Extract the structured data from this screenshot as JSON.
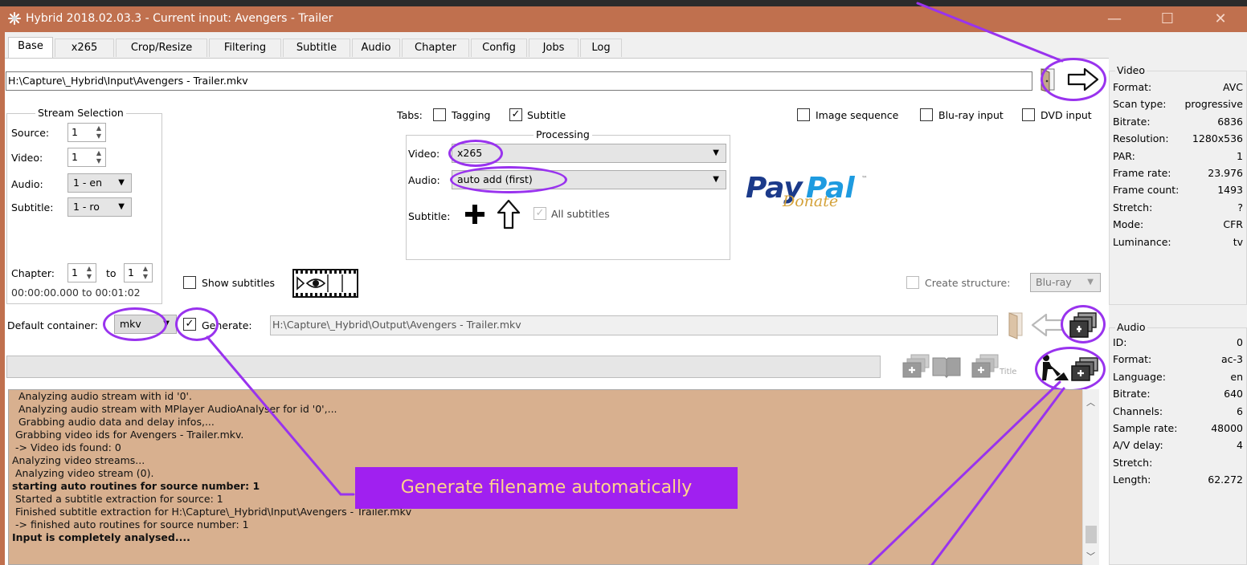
{
  "window": {
    "title": "Hybrid 2018.02.03.3 - Current input: Avengers - Trailer",
    "minimize": "—",
    "maximize": "☐",
    "close": "✕"
  },
  "tabs": [
    "Base",
    "x265",
    "Crop/Resize",
    "Filtering",
    "Subtitle",
    "Audio",
    "Chapter",
    "Config",
    "Jobs",
    "Log"
  ],
  "input_path": "H:\\Capture\\_Hybrid\\Input\\Avengers - Trailer.mkv",
  "stream_selection": {
    "title": "Stream Selection",
    "source_label": "Source:",
    "source_value": "1",
    "video_label": "Video:",
    "video_value": "1",
    "audio_label": "Audio:",
    "audio_value": "1 - en",
    "subtitle_label": "Subtitle:",
    "subtitle_value": "1 - ro",
    "chapter_label": "Chapter:",
    "chapter_from": "1",
    "to_label": "to",
    "chapter_to": "1",
    "time_range": "00:00:00.000 to 00:01:02"
  },
  "tabs_options": {
    "label": "Tabs:",
    "tagging": "Tagging",
    "subtitle": "Subtitle"
  },
  "processing": {
    "title": "Processing",
    "video_label": "Video:",
    "video_value": "x265",
    "audio_label": "Audio:",
    "audio_value": "auto add (first)",
    "subtitle_label": "Subtitle:",
    "all_subtitles": "All subtitles"
  },
  "paypal": {
    "brand_a": "Pay",
    "brand_b": "Pal",
    "tm": "™",
    "donate": "Donate"
  },
  "inputs_type": {
    "image_sequence": "Image sequence",
    "bluray_input": "Blu-ray input",
    "dvd_input": "DVD input"
  },
  "show_subtitles": "Show subtitles",
  "create_structure": {
    "label": "Create structure:",
    "value": "Blu-ray"
  },
  "output": {
    "default_container_label": "Default container:",
    "container_value": "mkv",
    "generate_label": "Generate:",
    "path": "H:\\Capture\\_Hybrid\\Output\\Avengers - Trailer.mkv"
  },
  "title_icon_label": "Title",
  "video_info": {
    "title": "Video",
    "rows": [
      {
        "k": "Format:",
        "v": "AVC"
      },
      {
        "k": "Scan type:",
        "v": "progressive"
      },
      {
        "k": "Bitrate:",
        "v": "6836"
      },
      {
        "k": "Resolution:",
        "v": "1280x536"
      },
      {
        "k": "PAR:",
        "v": "1"
      },
      {
        "k": "Frame rate:",
        "v": "23.976"
      },
      {
        "k": "Frame count:",
        "v": "1493"
      },
      {
        "k": "Stretch:",
        "v": "?"
      },
      {
        "k": "Mode:",
        "v": "CFR"
      },
      {
        "k": "Luminance:",
        "v": "tv"
      }
    ]
  },
  "audio_info": {
    "title": "Audio",
    "rows": [
      {
        "k": "ID:",
        "v": "0"
      },
      {
        "k": "Format:",
        "v": "ac-3"
      },
      {
        "k": "Language:",
        "v": "en"
      },
      {
        "k": "Bitrate:",
        "v": "640"
      },
      {
        "k": "Channels:",
        "v": "6"
      },
      {
        "k": "Sample rate:",
        "v": "48000"
      },
      {
        "k": "A/V delay:",
        "v": "4"
      },
      {
        "k": "Stretch:",
        "v": ""
      },
      {
        "k": "Length:",
        "v": "62.272"
      }
    ]
  },
  "log_lines": [
    {
      "t": "Analyzing audio stream with id '0'.",
      "b": false
    },
    {
      "t": "  Analyzing audio stream with MPlayer AudioAnalyser for id '0',...",
      "b": false
    },
    {
      "t": "  Grabbing audio data and delay infos,...",
      "b": false
    },
    {
      "t": " Grabbing video ids for Avengers - Trailer.mkv.",
      "b": false
    },
    {
      "t": " -> Video ids found: 0",
      "b": false
    },
    {
      "t": "Analyzing video streams...",
      "b": false
    },
    {
      "t": " Analyzing video stream (0).",
      "b": false
    },
    {
      "t": "starting auto routines for source number: 1",
      "b": true
    },
    {
      "t": " Started a subtitle extraction for source: 1",
      "b": false
    },
    {
      "t": " Finished subtitle extraction for H:\\Capture\\_Hybrid\\Input\\Avengers - Trailer.mkv",
      "b": false
    },
    {
      "t": " -> finished auto routines for source number: 1",
      "b": false
    },
    {
      "t": "Input is completely analysed....",
      "b": true
    }
  ],
  "annotation": {
    "callout_text": "Generate filename automatically",
    "color": "#a020f0"
  }
}
